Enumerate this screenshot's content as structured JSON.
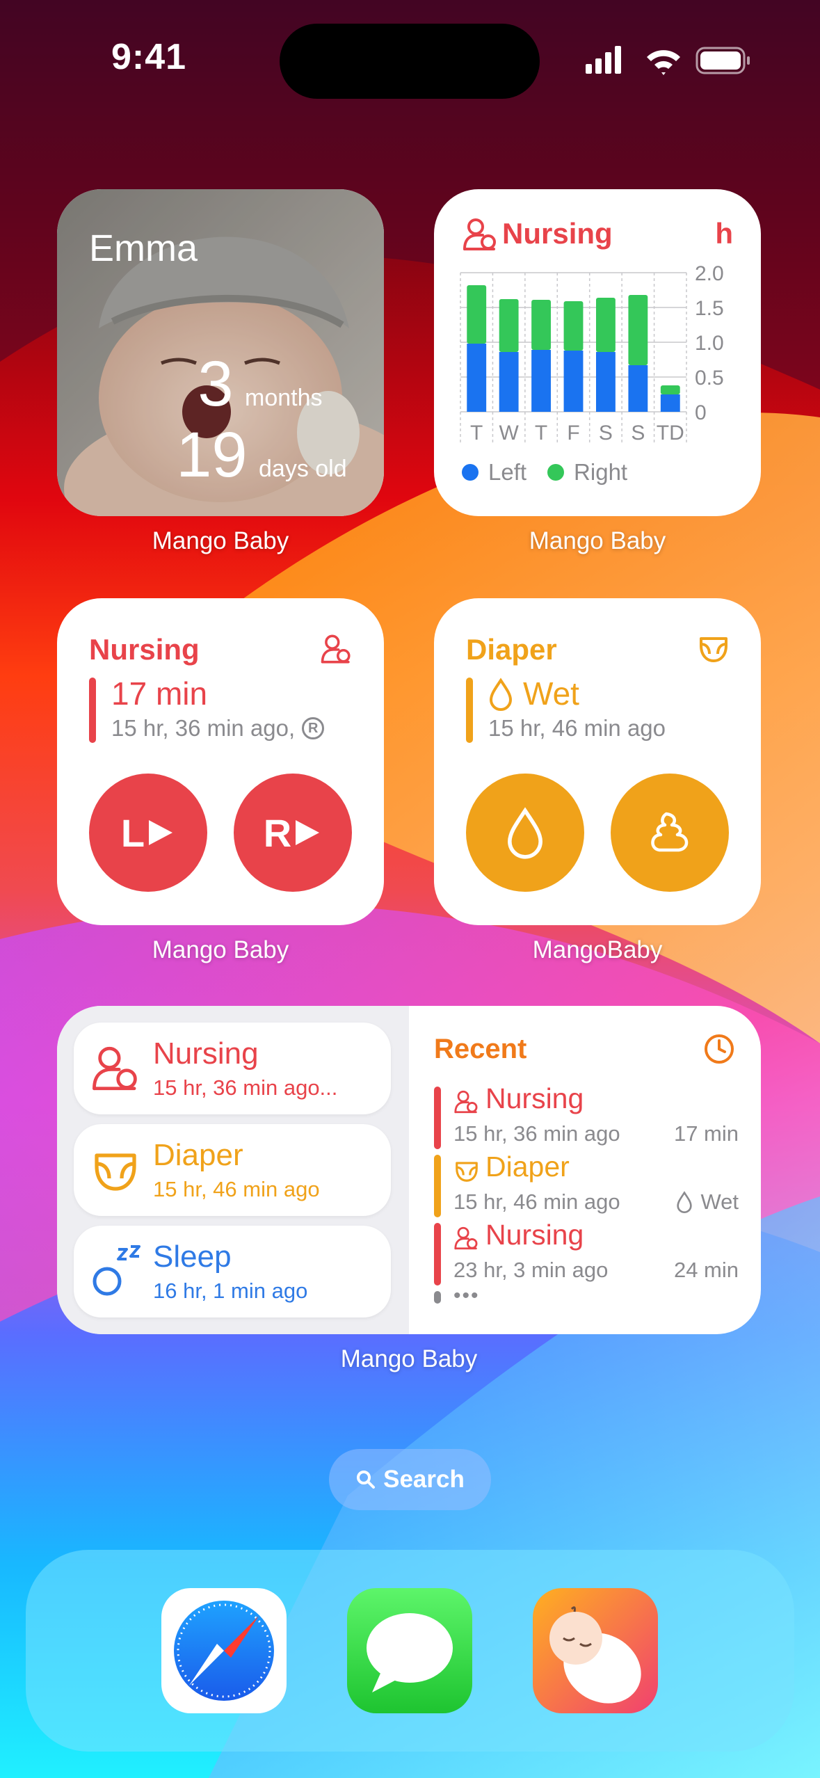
{
  "status_bar": {
    "time": "9:41"
  },
  "photo_widget": {
    "name": "Emma",
    "months_value": "3",
    "months_unit": "months",
    "days_value": "19",
    "days_unit": "days old",
    "app_label": "Mango Baby"
  },
  "chart_widget": {
    "title": "Nursing",
    "unit": "h",
    "app_label": "Mango Baby",
    "legend_left": "Left",
    "legend_right": "Right",
    "colors": {
      "left": "#1a73f0",
      "right": "#34c759"
    }
  },
  "chart_data": {
    "type": "bar",
    "title": "Nursing",
    "categories": [
      "T",
      "W",
      "T",
      "F",
      "S",
      "S",
      "TD"
    ],
    "ylabel": "h",
    "ylim": [
      0,
      2.0
    ],
    "yticks": [
      "2.0",
      "1.5",
      "1.0",
      "0.5",
      "0"
    ],
    "stacked": true,
    "series": [
      {
        "name": "Left",
        "values": [
          0.98,
          0.86,
          0.89,
          0.88,
          0.86,
          0.67,
          0.25
        ]
      },
      {
        "name": "Right",
        "values": [
          0.84,
          0.76,
          0.72,
          0.71,
          0.78,
          1.01,
          0.13
        ]
      }
    ],
    "legend": "bottom-left"
  },
  "nursing_widget": {
    "title": "Nursing",
    "duration": "17 min",
    "ago": "15 hr, 36 min ago,",
    "side_badge": "R",
    "left_button": "L",
    "right_button": "R",
    "app_label": "Mango Baby"
  },
  "diaper_widget": {
    "title": "Diaper",
    "status": "Wet",
    "ago": "15 hr, 46 min ago",
    "app_label": "MangoBaby"
  },
  "large_widget": {
    "app_label": "Mango Baby",
    "pills": [
      {
        "title": "Nursing",
        "sub": "15 hr, 36 min ago..."
      },
      {
        "title": "Diaper",
        "sub": "15 hr, 46 min ago"
      },
      {
        "title": "Sleep",
        "sub": "16 hr, 1 min ago"
      }
    ],
    "recent": {
      "title": "Recent",
      "items": [
        {
          "title": "Nursing",
          "ago": "15 hr, 36 min ago",
          "value": "17 min"
        },
        {
          "title": "Diaper",
          "ago": "15 hr, 46 min ago",
          "value": "Wet"
        },
        {
          "title": "Nursing",
          "ago": "23 hr, 3 min ago",
          "value": "24 min"
        }
      ],
      "more": "•••"
    }
  },
  "search": {
    "label": "Search"
  },
  "dock": {
    "apps": [
      "Safari",
      "Messages",
      "Mango Baby"
    ]
  }
}
